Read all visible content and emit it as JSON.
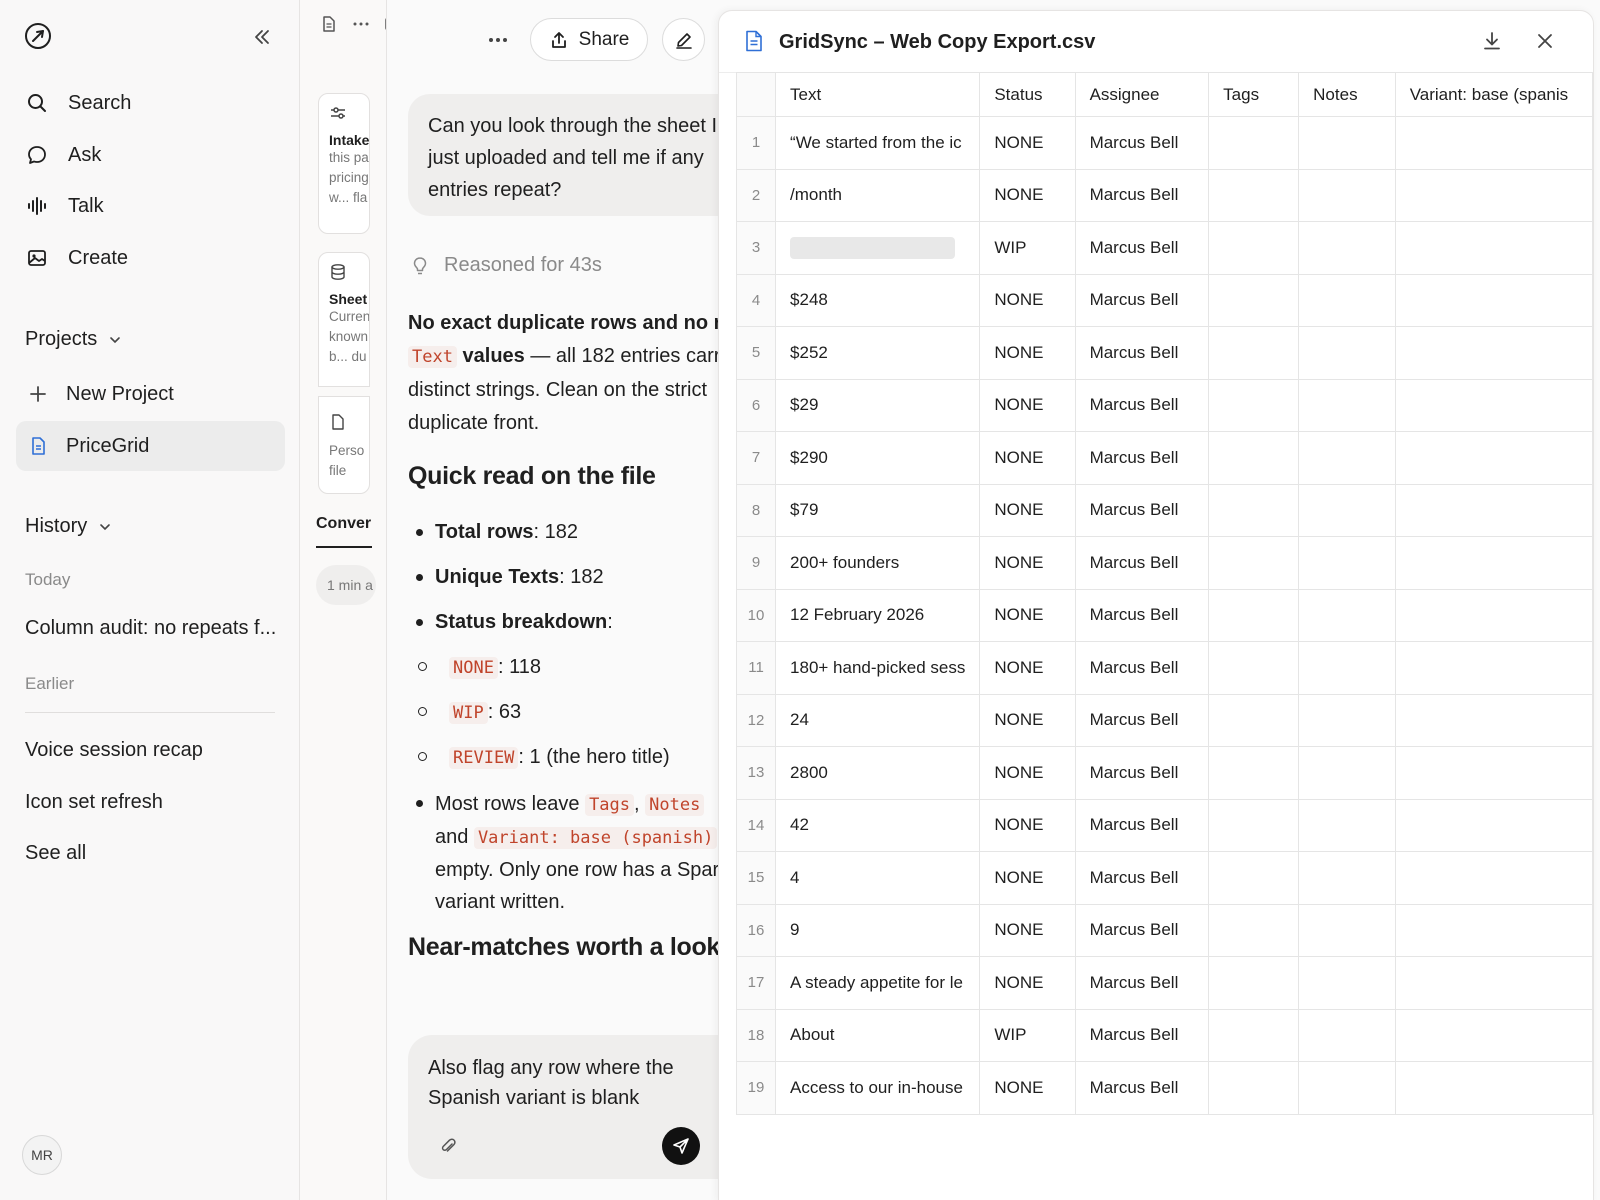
{
  "sidebar": {
    "nav": [
      {
        "label": "Search",
        "icon": "search-icon"
      },
      {
        "label": "Ask",
        "icon": "chat-bubble-icon"
      },
      {
        "label": "Talk",
        "icon": "waveform-icon"
      },
      {
        "label": "Create",
        "icon": "image-icon"
      }
    ],
    "projects_heading": "Projects",
    "new_project": "New Project",
    "active_project": "PriceGrid",
    "history_heading": "History",
    "today_label": "Today",
    "today_items": [
      "Column audit: no repeats f..."
    ],
    "earlier_label": "Earlier",
    "earlier_items": [
      "Voice session recap",
      "Icon set refresh"
    ],
    "see_all": "See all",
    "avatar_initials": "MR"
  },
  "rail": {
    "cards": [
      {
        "title": "Intake",
        "lines": [
          "this pa",
          "pricing",
          "w... fla"
        ],
        "icon": "sliders-icon"
      },
      {
        "title": "Sheet",
        "lines": [
          "Curren",
          "known",
          "b... du"
        ],
        "icon": "database-icon"
      },
      {
        "title": "",
        "lines": [
          "Perso",
          "file"
        ],
        "icon": "file-icon"
      }
    ],
    "tab_label": "Conver",
    "chip_label": "1 min a"
  },
  "chat": {
    "share_label": "Share",
    "user_message": "Can you look through the sheet I just uploaded and tell me if any entries repeat?",
    "reasoned": "Reasoned for 43s",
    "para_bold_1": "No exact duplicate rows and no r",
    "para_code": "Text",
    "para_bold_2": "values",
    "para_rest": " — all 182 entries carr distinct strings. Clean on the strict duplicate front.",
    "heading_1": "Quick read on the file",
    "total_rows_label": "Total rows",
    "total_rows_value": ": 182",
    "unique_label": "Unique Texts",
    "unique_value": ": 182",
    "status_label": "Status breakdown",
    "status_colon": ":",
    "status_items": [
      {
        "code": "NONE",
        "text": ": 118"
      },
      {
        "code": "WIP",
        "text": ": 63"
      },
      {
        "code": "REVIEW",
        "text": ": 1 (the hero title)"
      }
    ],
    "most_rows_pre": "Most rows leave ",
    "most_rows_code_1": "Tags",
    "most_rows_sep": ", ",
    "most_rows_code_2": "Notes",
    "most_rows_and": "and ",
    "most_rows_code_3": "Variant: base (spanish)",
    "most_rows_post": "empty. Only one row has a Spar variant written.",
    "heading_2": "Near-matches worth a look",
    "composer_text": "Also flag any row where the Spanish variant is blank"
  },
  "panel": {
    "title": "GridSync – Web Copy Export.csv",
    "columns": [
      "Text",
      "Status",
      "Assignee",
      "Tags",
      "Notes",
      "Variant: base (spanis"
    ],
    "rows": [
      {
        "n": "1",
        "text": "“We started from the ic",
        "status": "NONE",
        "assignee": "Marcus Bell"
      },
      {
        "n": "2",
        "text": "/month",
        "status": "NONE",
        "assignee": "Marcus Bell"
      },
      {
        "n": "3",
        "text": "",
        "status": "WIP",
        "assignee": "Marcus Bell"
      },
      {
        "n": "4",
        "text": "$248",
        "status": "NONE",
        "assignee": "Marcus Bell"
      },
      {
        "n": "5",
        "text": "$252",
        "status": "NONE",
        "assignee": "Marcus Bell"
      },
      {
        "n": "6",
        "text": "$29",
        "status": "NONE",
        "assignee": "Marcus Bell"
      },
      {
        "n": "7",
        "text": "$290",
        "status": "NONE",
        "assignee": "Marcus Bell"
      },
      {
        "n": "8",
        "text": "$79",
        "status": "NONE",
        "assignee": "Marcus Bell"
      },
      {
        "n": "9",
        "text": "200+ founders",
        "status": "NONE",
        "assignee": "Marcus Bell"
      },
      {
        "n": "10",
        "text": "12 February 2026",
        "status": "NONE",
        "assignee": "Marcus Bell"
      },
      {
        "n": "11",
        "text": "180+ hand-picked sess",
        "status": "NONE",
        "assignee": "Marcus Bell"
      },
      {
        "n": "12",
        "text": "24",
        "status": "NONE",
        "assignee": "Marcus Bell"
      },
      {
        "n": "13",
        "text": "2800",
        "status": "NONE",
        "assignee": "Marcus Bell"
      },
      {
        "n": "14",
        "text": "42",
        "status": "NONE",
        "assignee": "Marcus Bell"
      },
      {
        "n": "15",
        "text": "4",
        "status": "NONE",
        "assignee": "Marcus Bell"
      },
      {
        "n": "16",
        "text": "9",
        "status": "NONE",
        "assignee": "Marcus Bell"
      },
      {
        "n": "17",
        "text": "A steady appetite for le",
        "status": "NONE",
        "assignee": "Marcus Bell"
      },
      {
        "n": "18",
        "text": "About",
        "status": "WIP",
        "assignee": "Marcus Bell"
      },
      {
        "n": "19",
        "text": "Access to our in-house",
        "status": "NONE",
        "assignee": "Marcus Bell"
      }
    ]
  }
}
